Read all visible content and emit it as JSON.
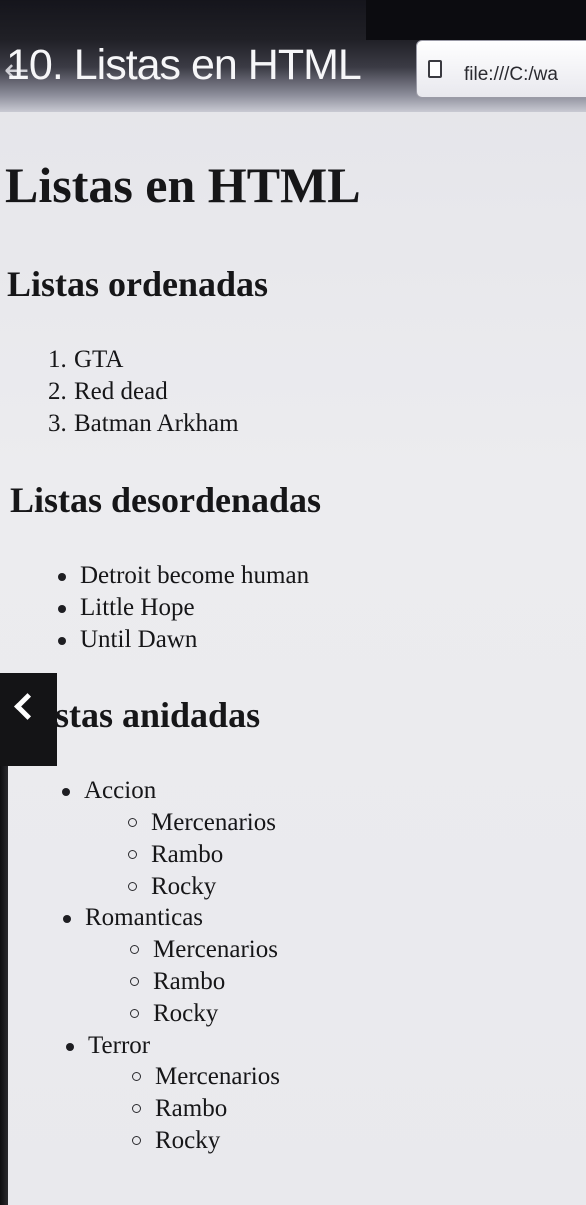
{
  "browser": {
    "tab_title": "10. Listas en HTML",
    "back_glyph": "←",
    "url": "file:///C:/wa"
  },
  "page": {
    "title": "Listas en HTML",
    "ordered": {
      "heading": "Listas ordenadas",
      "items": [
        {
          "num": "1.",
          "text": "GTA"
        },
        {
          "num": "2.",
          "text": "Red dead"
        },
        {
          "num": "3.",
          "text": "Batman Arkham"
        }
      ]
    },
    "unordered": {
      "heading": "Listas desordenadas",
      "items": [
        "Detroit become human",
        "Little Hope",
        "Until Dawn"
      ]
    },
    "nested": {
      "heading": "stas anidadas",
      "groups": [
        {
          "label": "Accion",
          "children": [
            "Mercenarios",
            "Rambo",
            "Rocky"
          ]
        },
        {
          "label": "Romanticas",
          "children": [
            "Mercenarios",
            "Rambo",
            "Rocky"
          ]
        },
        {
          "label": "Terror",
          "children": [
            "Mercenarios",
            "Rambo",
            "Rocky"
          ]
        }
      ]
    }
  },
  "side_tab": {
    "icon": "chevron-left-icon"
  }
}
